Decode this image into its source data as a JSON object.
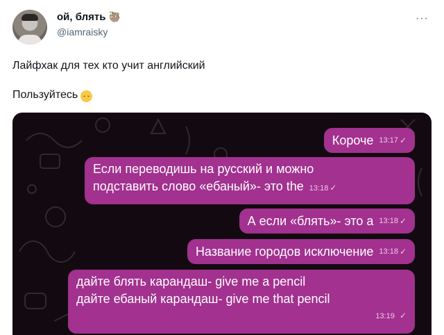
{
  "tweet": {
    "display_name": "ой, блять",
    "name_emoji": "sloth-icon",
    "handle": "@iamraisky",
    "text_line1": "Лайфхак для тех кто учит английский",
    "text_line2": "Пользуйтесь",
    "text_emoji": "relieved-face-icon"
  },
  "chat": {
    "messages": [
      {
        "text": "Короче",
        "time": "13:17"
      },
      {
        "line1": "Если переводишь на русский и можно",
        "line2": "подставить слово «ебаный»- это the",
        "time": "13:18"
      },
      {
        "text": "А если «блять»- это a",
        "time": "13:18"
      },
      {
        "text": "Название городов исключение",
        "time": "13:18"
      },
      {
        "line1": "дайте блять карандаш- give me a pencil",
        "line2": "дайте ебаный карандаш- give me that pencil",
        "time": "13:19"
      }
    ],
    "read_mark": "✓",
    "bubble_color": "#a2318f",
    "background_color": "#120a10"
  }
}
